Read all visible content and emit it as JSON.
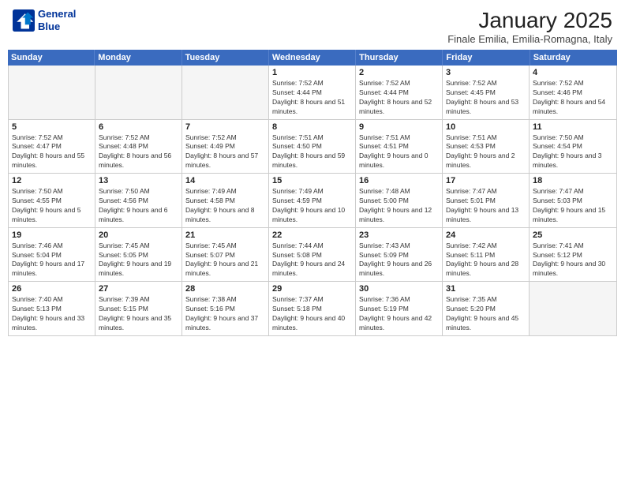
{
  "header": {
    "logo_line1": "General",
    "logo_line2": "Blue",
    "month": "January 2025",
    "location": "Finale Emilia, Emilia-Romagna, Italy"
  },
  "weekdays": [
    "Sunday",
    "Monday",
    "Tuesday",
    "Wednesday",
    "Thursday",
    "Friday",
    "Saturday"
  ],
  "rows": [
    [
      {
        "day": "",
        "info": ""
      },
      {
        "day": "",
        "info": ""
      },
      {
        "day": "",
        "info": ""
      },
      {
        "day": "1",
        "info": "Sunrise: 7:52 AM\nSunset: 4:44 PM\nDaylight: 8 hours and 51 minutes."
      },
      {
        "day": "2",
        "info": "Sunrise: 7:52 AM\nSunset: 4:44 PM\nDaylight: 8 hours and 52 minutes."
      },
      {
        "day": "3",
        "info": "Sunrise: 7:52 AM\nSunset: 4:45 PM\nDaylight: 8 hours and 53 minutes."
      },
      {
        "day": "4",
        "info": "Sunrise: 7:52 AM\nSunset: 4:46 PM\nDaylight: 8 hours and 54 minutes."
      }
    ],
    [
      {
        "day": "5",
        "info": "Sunrise: 7:52 AM\nSunset: 4:47 PM\nDaylight: 8 hours and 55 minutes."
      },
      {
        "day": "6",
        "info": "Sunrise: 7:52 AM\nSunset: 4:48 PM\nDaylight: 8 hours and 56 minutes."
      },
      {
        "day": "7",
        "info": "Sunrise: 7:52 AM\nSunset: 4:49 PM\nDaylight: 8 hours and 57 minutes."
      },
      {
        "day": "8",
        "info": "Sunrise: 7:51 AM\nSunset: 4:50 PM\nDaylight: 8 hours and 59 minutes."
      },
      {
        "day": "9",
        "info": "Sunrise: 7:51 AM\nSunset: 4:51 PM\nDaylight: 9 hours and 0 minutes."
      },
      {
        "day": "10",
        "info": "Sunrise: 7:51 AM\nSunset: 4:53 PM\nDaylight: 9 hours and 2 minutes."
      },
      {
        "day": "11",
        "info": "Sunrise: 7:50 AM\nSunset: 4:54 PM\nDaylight: 9 hours and 3 minutes."
      }
    ],
    [
      {
        "day": "12",
        "info": "Sunrise: 7:50 AM\nSunset: 4:55 PM\nDaylight: 9 hours and 5 minutes."
      },
      {
        "day": "13",
        "info": "Sunrise: 7:50 AM\nSunset: 4:56 PM\nDaylight: 9 hours and 6 minutes."
      },
      {
        "day": "14",
        "info": "Sunrise: 7:49 AM\nSunset: 4:58 PM\nDaylight: 9 hours and 8 minutes."
      },
      {
        "day": "15",
        "info": "Sunrise: 7:49 AM\nSunset: 4:59 PM\nDaylight: 9 hours and 10 minutes."
      },
      {
        "day": "16",
        "info": "Sunrise: 7:48 AM\nSunset: 5:00 PM\nDaylight: 9 hours and 12 minutes."
      },
      {
        "day": "17",
        "info": "Sunrise: 7:47 AM\nSunset: 5:01 PM\nDaylight: 9 hours and 13 minutes."
      },
      {
        "day": "18",
        "info": "Sunrise: 7:47 AM\nSunset: 5:03 PM\nDaylight: 9 hours and 15 minutes."
      }
    ],
    [
      {
        "day": "19",
        "info": "Sunrise: 7:46 AM\nSunset: 5:04 PM\nDaylight: 9 hours and 17 minutes."
      },
      {
        "day": "20",
        "info": "Sunrise: 7:45 AM\nSunset: 5:05 PM\nDaylight: 9 hours and 19 minutes."
      },
      {
        "day": "21",
        "info": "Sunrise: 7:45 AM\nSunset: 5:07 PM\nDaylight: 9 hours and 21 minutes."
      },
      {
        "day": "22",
        "info": "Sunrise: 7:44 AM\nSunset: 5:08 PM\nDaylight: 9 hours and 24 minutes."
      },
      {
        "day": "23",
        "info": "Sunrise: 7:43 AM\nSunset: 5:09 PM\nDaylight: 9 hours and 26 minutes."
      },
      {
        "day": "24",
        "info": "Sunrise: 7:42 AM\nSunset: 5:11 PM\nDaylight: 9 hours and 28 minutes."
      },
      {
        "day": "25",
        "info": "Sunrise: 7:41 AM\nSunset: 5:12 PM\nDaylight: 9 hours and 30 minutes."
      }
    ],
    [
      {
        "day": "26",
        "info": "Sunrise: 7:40 AM\nSunset: 5:13 PM\nDaylight: 9 hours and 33 minutes."
      },
      {
        "day": "27",
        "info": "Sunrise: 7:39 AM\nSunset: 5:15 PM\nDaylight: 9 hours and 35 minutes."
      },
      {
        "day": "28",
        "info": "Sunrise: 7:38 AM\nSunset: 5:16 PM\nDaylight: 9 hours and 37 minutes."
      },
      {
        "day": "29",
        "info": "Sunrise: 7:37 AM\nSunset: 5:18 PM\nDaylight: 9 hours and 40 minutes."
      },
      {
        "day": "30",
        "info": "Sunrise: 7:36 AM\nSunset: 5:19 PM\nDaylight: 9 hours and 42 minutes."
      },
      {
        "day": "31",
        "info": "Sunrise: 7:35 AM\nSunset: 5:20 PM\nDaylight: 9 hours and 45 minutes."
      },
      {
        "day": "",
        "info": ""
      }
    ]
  ]
}
